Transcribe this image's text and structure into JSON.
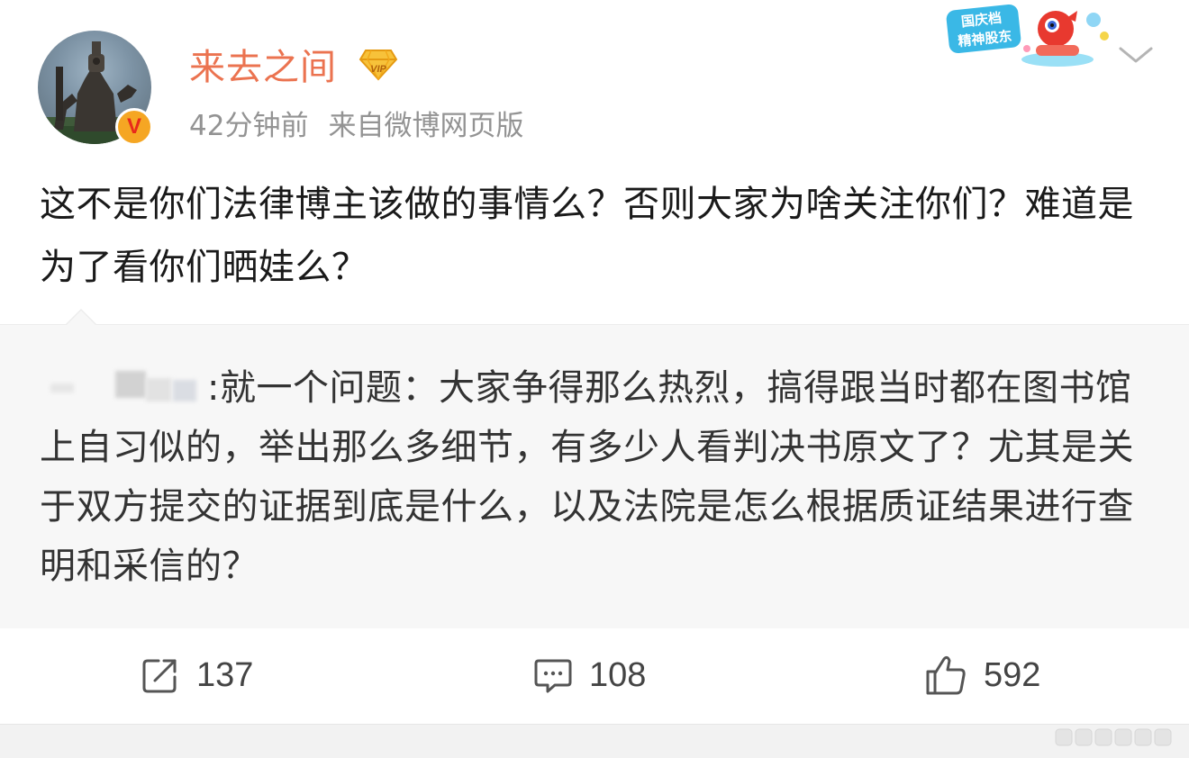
{
  "post": {
    "author": {
      "name": "来去之间",
      "avatar_icon": "robot-statue-avatar",
      "verified_icon": "orange-v-badge",
      "verified_mark": "V",
      "vip_icon": "gold-diamond-vip-icon",
      "vip_label": "VIP"
    },
    "meta": {
      "time": "42分钟前",
      "source": "来自微博网页版"
    },
    "text": "这不是你们法律博主该做的事情么？否则大家为啥关注你们？难道是为了看你们晒娃么？",
    "promo_badge": {
      "line1": "国庆档",
      "line2": "精神股东"
    },
    "menu_icon": "chevron-down-icon"
  },
  "repost": {
    "author_blurred": true,
    "text": ":就一个问题：大家争得那么热烈，搞得跟当时都在图书馆上自习似的，举出那么多细节，有多少人看判决书原文了？尤其是关于双方提交的证据到底是什么，以及法院是怎么根据质证结果进行查明和采信的？"
  },
  "actions": {
    "repost": {
      "icon": "share-edit-icon",
      "count": "137"
    },
    "comment": {
      "icon": "comment-bubble-icon",
      "count": "108"
    },
    "like": {
      "icon": "thumbs-up-icon",
      "count": "592"
    }
  },
  "colors": {
    "username": "#eb7350",
    "meta": "#939393",
    "repost_bg": "#f7f7f7",
    "text": "#1a1a1a"
  }
}
